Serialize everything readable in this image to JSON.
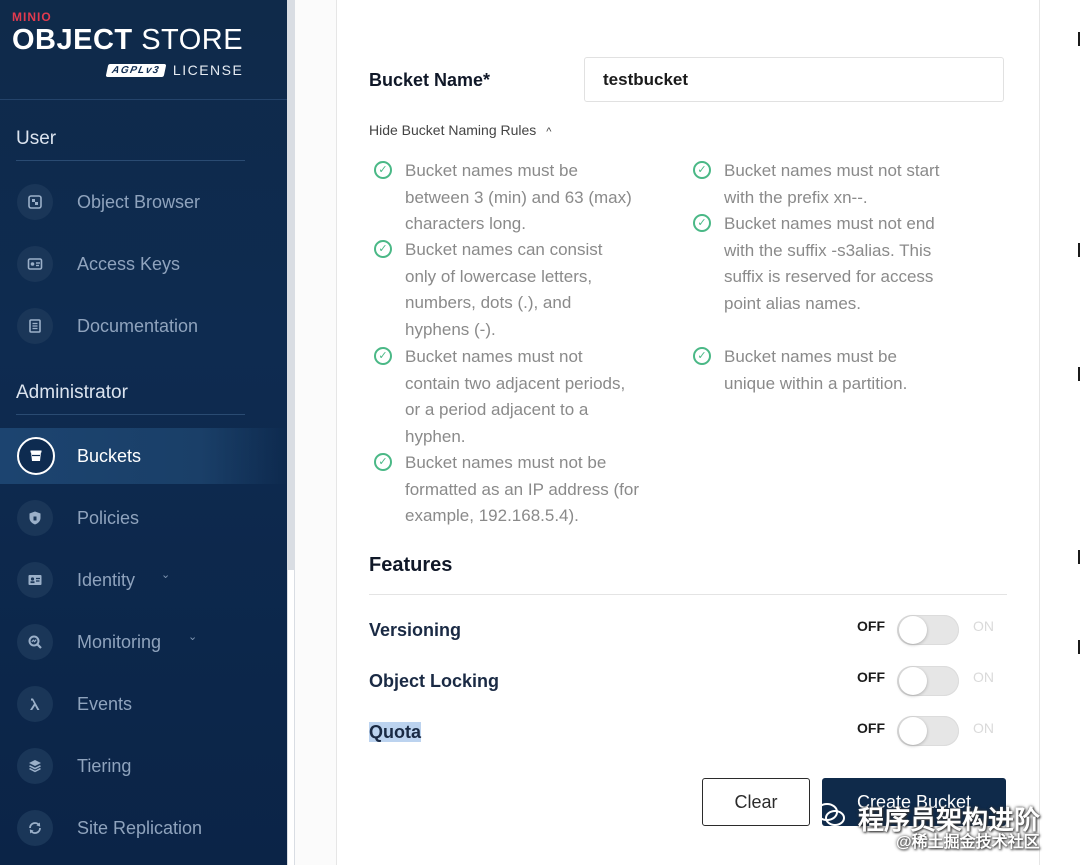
{
  "brand": {
    "minio": "MINIO",
    "object": "OBJECT",
    "store": "STORE",
    "agpl": "AGPLv3",
    "license": "LICENSE"
  },
  "sidebar": {
    "user_section": "User",
    "admin_section": "Administrator",
    "user_items": [
      {
        "label": "Object Browser",
        "icon": "object-browser-icon"
      },
      {
        "label": "Access Keys",
        "icon": "access-keys-icon"
      },
      {
        "label": "Documentation",
        "icon": "documentation-icon"
      }
    ],
    "admin_items": [
      {
        "label": "Buckets",
        "icon": "bucket-icon",
        "active": true
      },
      {
        "label": "Policies",
        "icon": "shield-icon"
      },
      {
        "label": "Identity",
        "icon": "identity-icon"
      },
      {
        "label": "Monitoring",
        "icon": "monitoring-icon"
      },
      {
        "label": "Events",
        "icon": "lambda-icon"
      },
      {
        "label": "Tiering",
        "icon": "layers-icon"
      },
      {
        "label": "Site Replication",
        "icon": "replication-icon"
      }
    ],
    "caret": "⌄"
  },
  "form": {
    "bucket_name_label": "Bucket Name*",
    "bucket_name_value": "testbucket",
    "rules_toggle": "Hide Bucket Naming Rules",
    "rules_caret": "^",
    "rules_left": [
      "Bucket names must be between 3 (min) and 63 (max) characters long.",
      "Bucket names can consist only of lowercase letters, numbers, dots (.), and hyphens (-).",
      "Bucket names must not contain two adjacent periods, or a period adjacent to a hyphen.",
      "Bucket names must not be formatted as an IP address (for example, 192.168.5.4)."
    ],
    "rules_right": [
      "Bucket names must not start with the prefix xn--.",
      "Bucket names must not end with the suffix -s3alias. This suffix is reserved for access point alias names.",
      "Bucket names must be unique within a partition."
    ]
  },
  "features": {
    "title": "Features",
    "off_label": "OFF",
    "on_label": "ON",
    "items": [
      {
        "label": "Versioning",
        "enabled": false
      },
      {
        "label": "Object Locking",
        "enabled": false
      },
      {
        "label": "Quota",
        "enabled": false
      }
    ]
  },
  "actions": {
    "clear": "Clear",
    "create": "Create Bucket"
  },
  "watermark": {
    "main": "程序员架构进阶",
    "sub": "@稀土掘金技术社区"
  }
}
